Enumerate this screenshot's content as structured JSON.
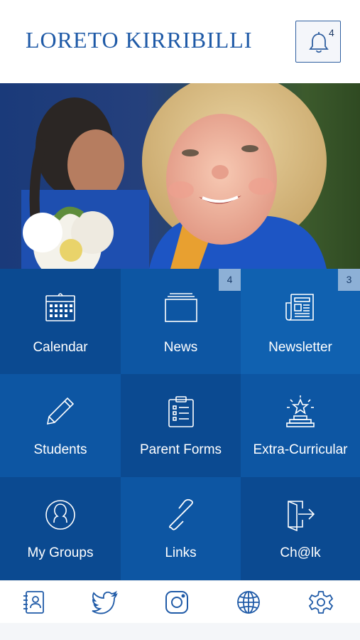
{
  "header": {
    "brand": "Loreto Kirribilli",
    "notification_count": "4"
  },
  "hero": {
    "icon": "photo-of-smiling-child"
  },
  "tiles": [
    {
      "label": "Calendar",
      "icon": "calendar-icon",
      "badge": ""
    },
    {
      "label": "News",
      "icon": "news-icon",
      "badge": "4"
    },
    {
      "label": "Newsletter",
      "icon": "newsletter-icon",
      "badge": "3"
    },
    {
      "label": "Students",
      "icon": "pencil-icon",
      "badge": ""
    },
    {
      "label": "Parent Forms",
      "icon": "clipboard-icon",
      "badge": ""
    },
    {
      "label": "Extra-Curricular",
      "icon": "star-podium-icon",
      "badge": ""
    },
    {
      "label": "My Groups",
      "icon": "person-circle-icon",
      "badge": ""
    },
    {
      "label": "Links",
      "icon": "link-icon",
      "badge": ""
    },
    {
      "label": "Ch@lk",
      "icon": "exit-door-icon",
      "badge": ""
    }
  ],
  "bottom_nav": [
    "contacts-icon",
    "twitter-icon",
    "instagram-icon",
    "globe-icon",
    "settings-icon"
  ],
  "colors": {
    "brand": "#1f5aa7",
    "tile_dark": "#0b4a91",
    "tile_mid": "#0d56a3",
    "tile_light": "#1061b0",
    "badge": "#8db0d6"
  }
}
